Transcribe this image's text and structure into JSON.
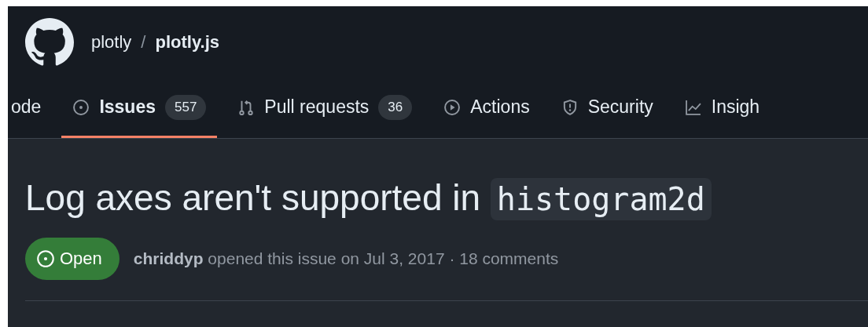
{
  "repo": {
    "owner": "plotly",
    "separator": "/",
    "name": "plotly.js"
  },
  "tabs": [
    {
      "label": "ode",
      "kind": "code",
      "selected": false
    },
    {
      "label": "Issues",
      "kind": "issues",
      "counter": "557",
      "selected": true
    },
    {
      "label": "Pull requests",
      "kind": "pulls",
      "counter": "36",
      "selected": false
    },
    {
      "label": "Actions",
      "kind": "actions",
      "selected": false
    },
    {
      "label": "Security",
      "kind": "security",
      "selected": false
    },
    {
      "label": "Insigh",
      "kind": "insights",
      "selected": false
    }
  ],
  "issue": {
    "title": "Log axes aren't supported in ",
    "title_code": "histogram2d",
    "state": {
      "label": "Open",
      "kind": "open"
    },
    "meta": "**chriddyp** opened this issue on Jul 3, 2017 · 18 comments"
  }
}
